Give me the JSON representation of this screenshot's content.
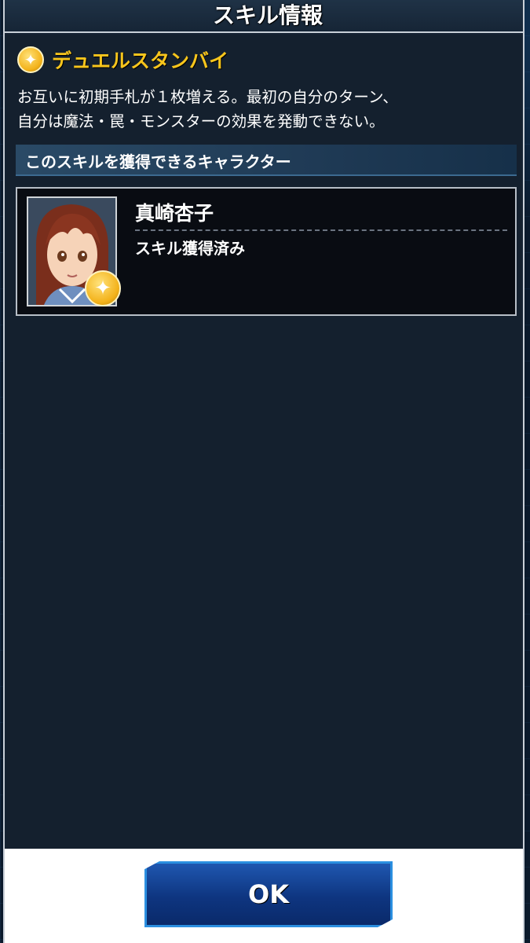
{
  "dialog": {
    "title": "スキル情報"
  },
  "skill": {
    "icon": "star-icon",
    "name": "デュエルスタンバイ",
    "description": "お互いに初期手札が１枚増える。最初の自分のターン、\n自分は魔法・罠・モンスターの効果を発動できない。"
  },
  "section": {
    "title": "このスキルを獲得できるキャラクター"
  },
  "characters": [
    {
      "name": "真崎杏子",
      "status": "スキル獲得済み"
    }
  ],
  "footer": {
    "ok_label": "OK"
  },
  "colors": {
    "skill_name": "#f7c51c",
    "badge": "#f3b21a",
    "ok_button": "#0e3580"
  }
}
